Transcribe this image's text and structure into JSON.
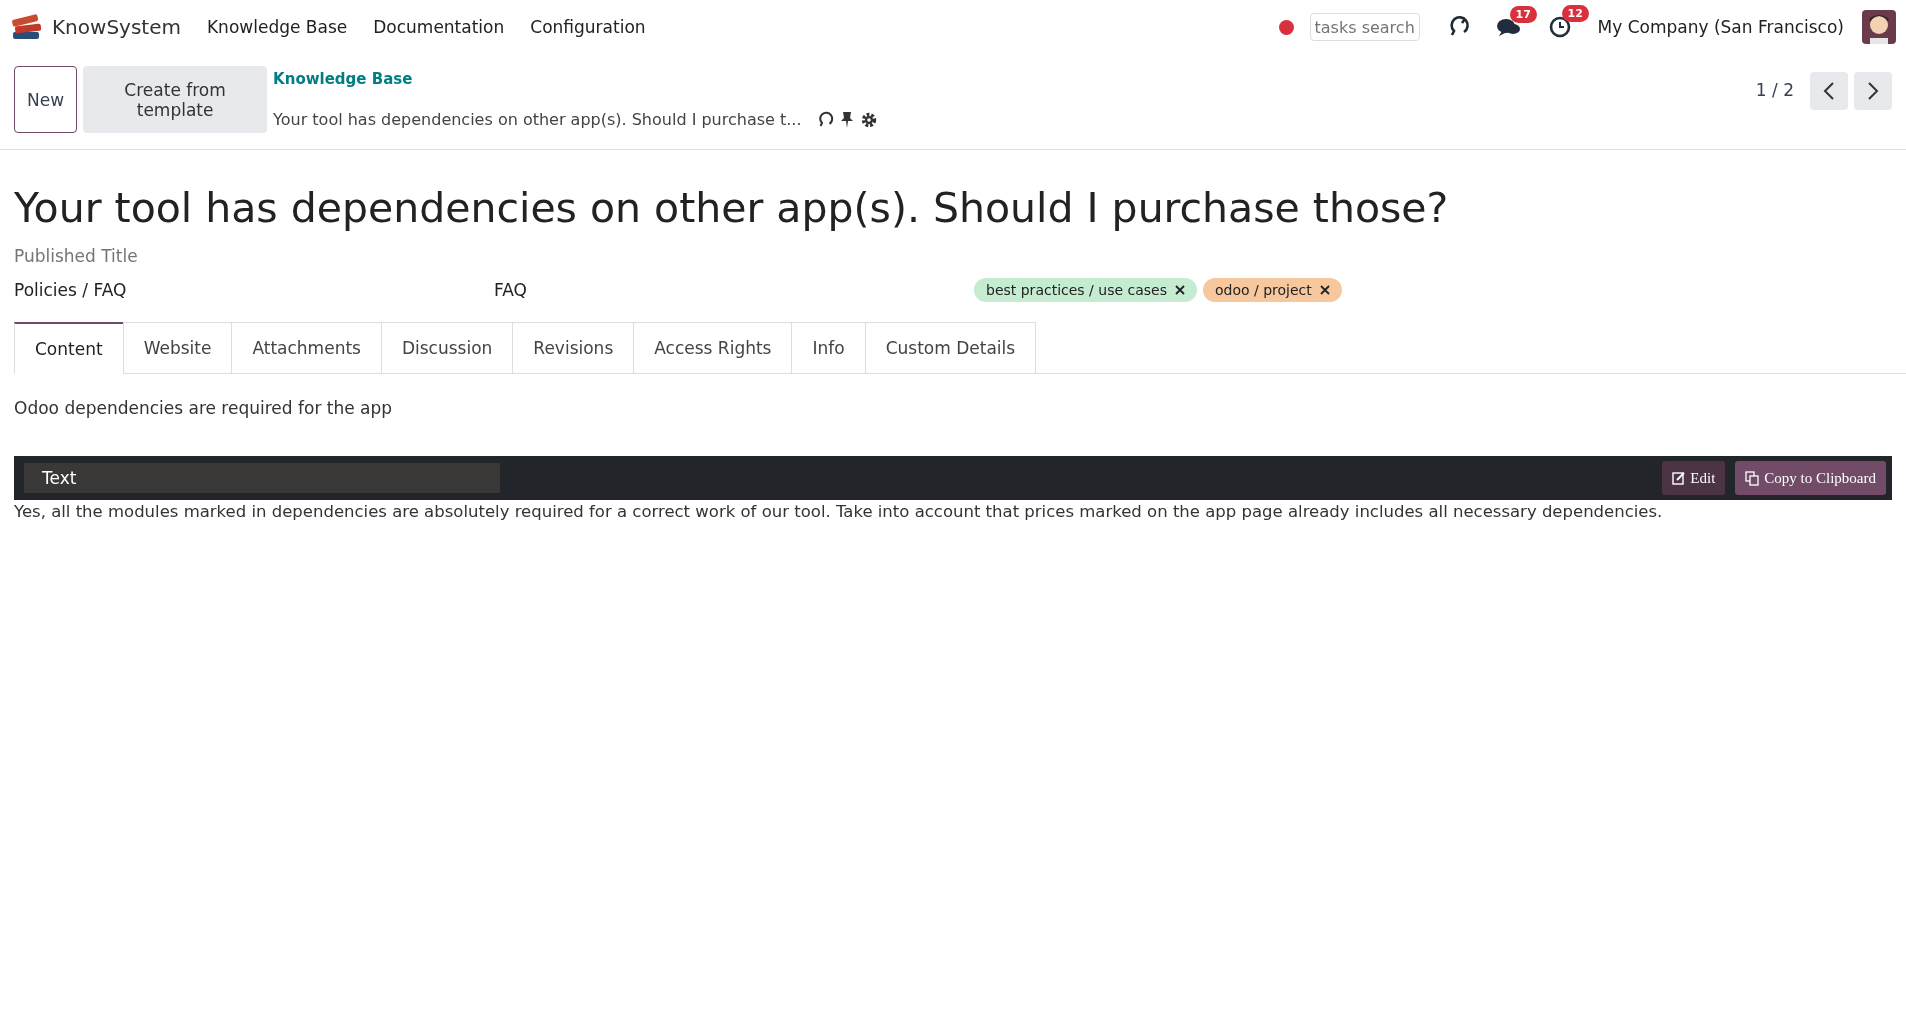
{
  "navbar": {
    "app_name": "KnowSystem",
    "menu": [
      "Knowledge Base",
      "Documentation",
      "Configuration"
    ],
    "search": {
      "placeholder": "tasks search"
    },
    "messages_badge": "17",
    "activities_badge": "12",
    "company": "My Company (San Francisco)"
  },
  "control_panel": {
    "buttons": [
      {
        "label": "New",
        "kind": "outline"
      },
      {
        "label": "Create from template",
        "kind": "secondary"
      }
    ],
    "breadcrumb": "Knowledge Base",
    "record_name": "Your tool has dependencies on other app(s). Should I purchase t...",
    "pager": "1 / 2"
  },
  "form": {
    "title": "Your tool has dependencies on other app(s). Should I purchase those?",
    "published_title": {
      "placeholder": "Published Title"
    },
    "section": "Policies / FAQ",
    "type": "FAQ",
    "tags": [
      {
        "label": "best practices / use cases",
        "color": "#c5ecd1"
      },
      {
        "label": "odoo / project",
        "color": "#f7c89d"
      }
    ],
    "tabs": [
      {
        "label": "Content",
        "selected": true
      },
      {
        "label": "Website",
        "selected": false
      },
      {
        "label": "Attachments",
        "selected": false
      },
      {
        "label": "Discussion",
        "selected": false
      },
      {
        "label": "Revisions",
        "selected": false
      },
      {
        "label": "Access Rights",
        "selected": false
      },
      {
        "label": "Info",
        "selected": false
      },
      {
        "label": "Custom Details",
        "selected": false
      }
    ],
    "description": "Odoo dependencies are required for the app",
    "snippet": {
      "format": "Text",
      "edit_label": "Edit",
      "copy_label": "Copy to Clipboard",
      "body": "Yes, all the modules marked in dependencies are absolutely required for a correct work of our tool. Take into account that prices marked on the app page already includes all necessary dependencies."
    }
  }
}
